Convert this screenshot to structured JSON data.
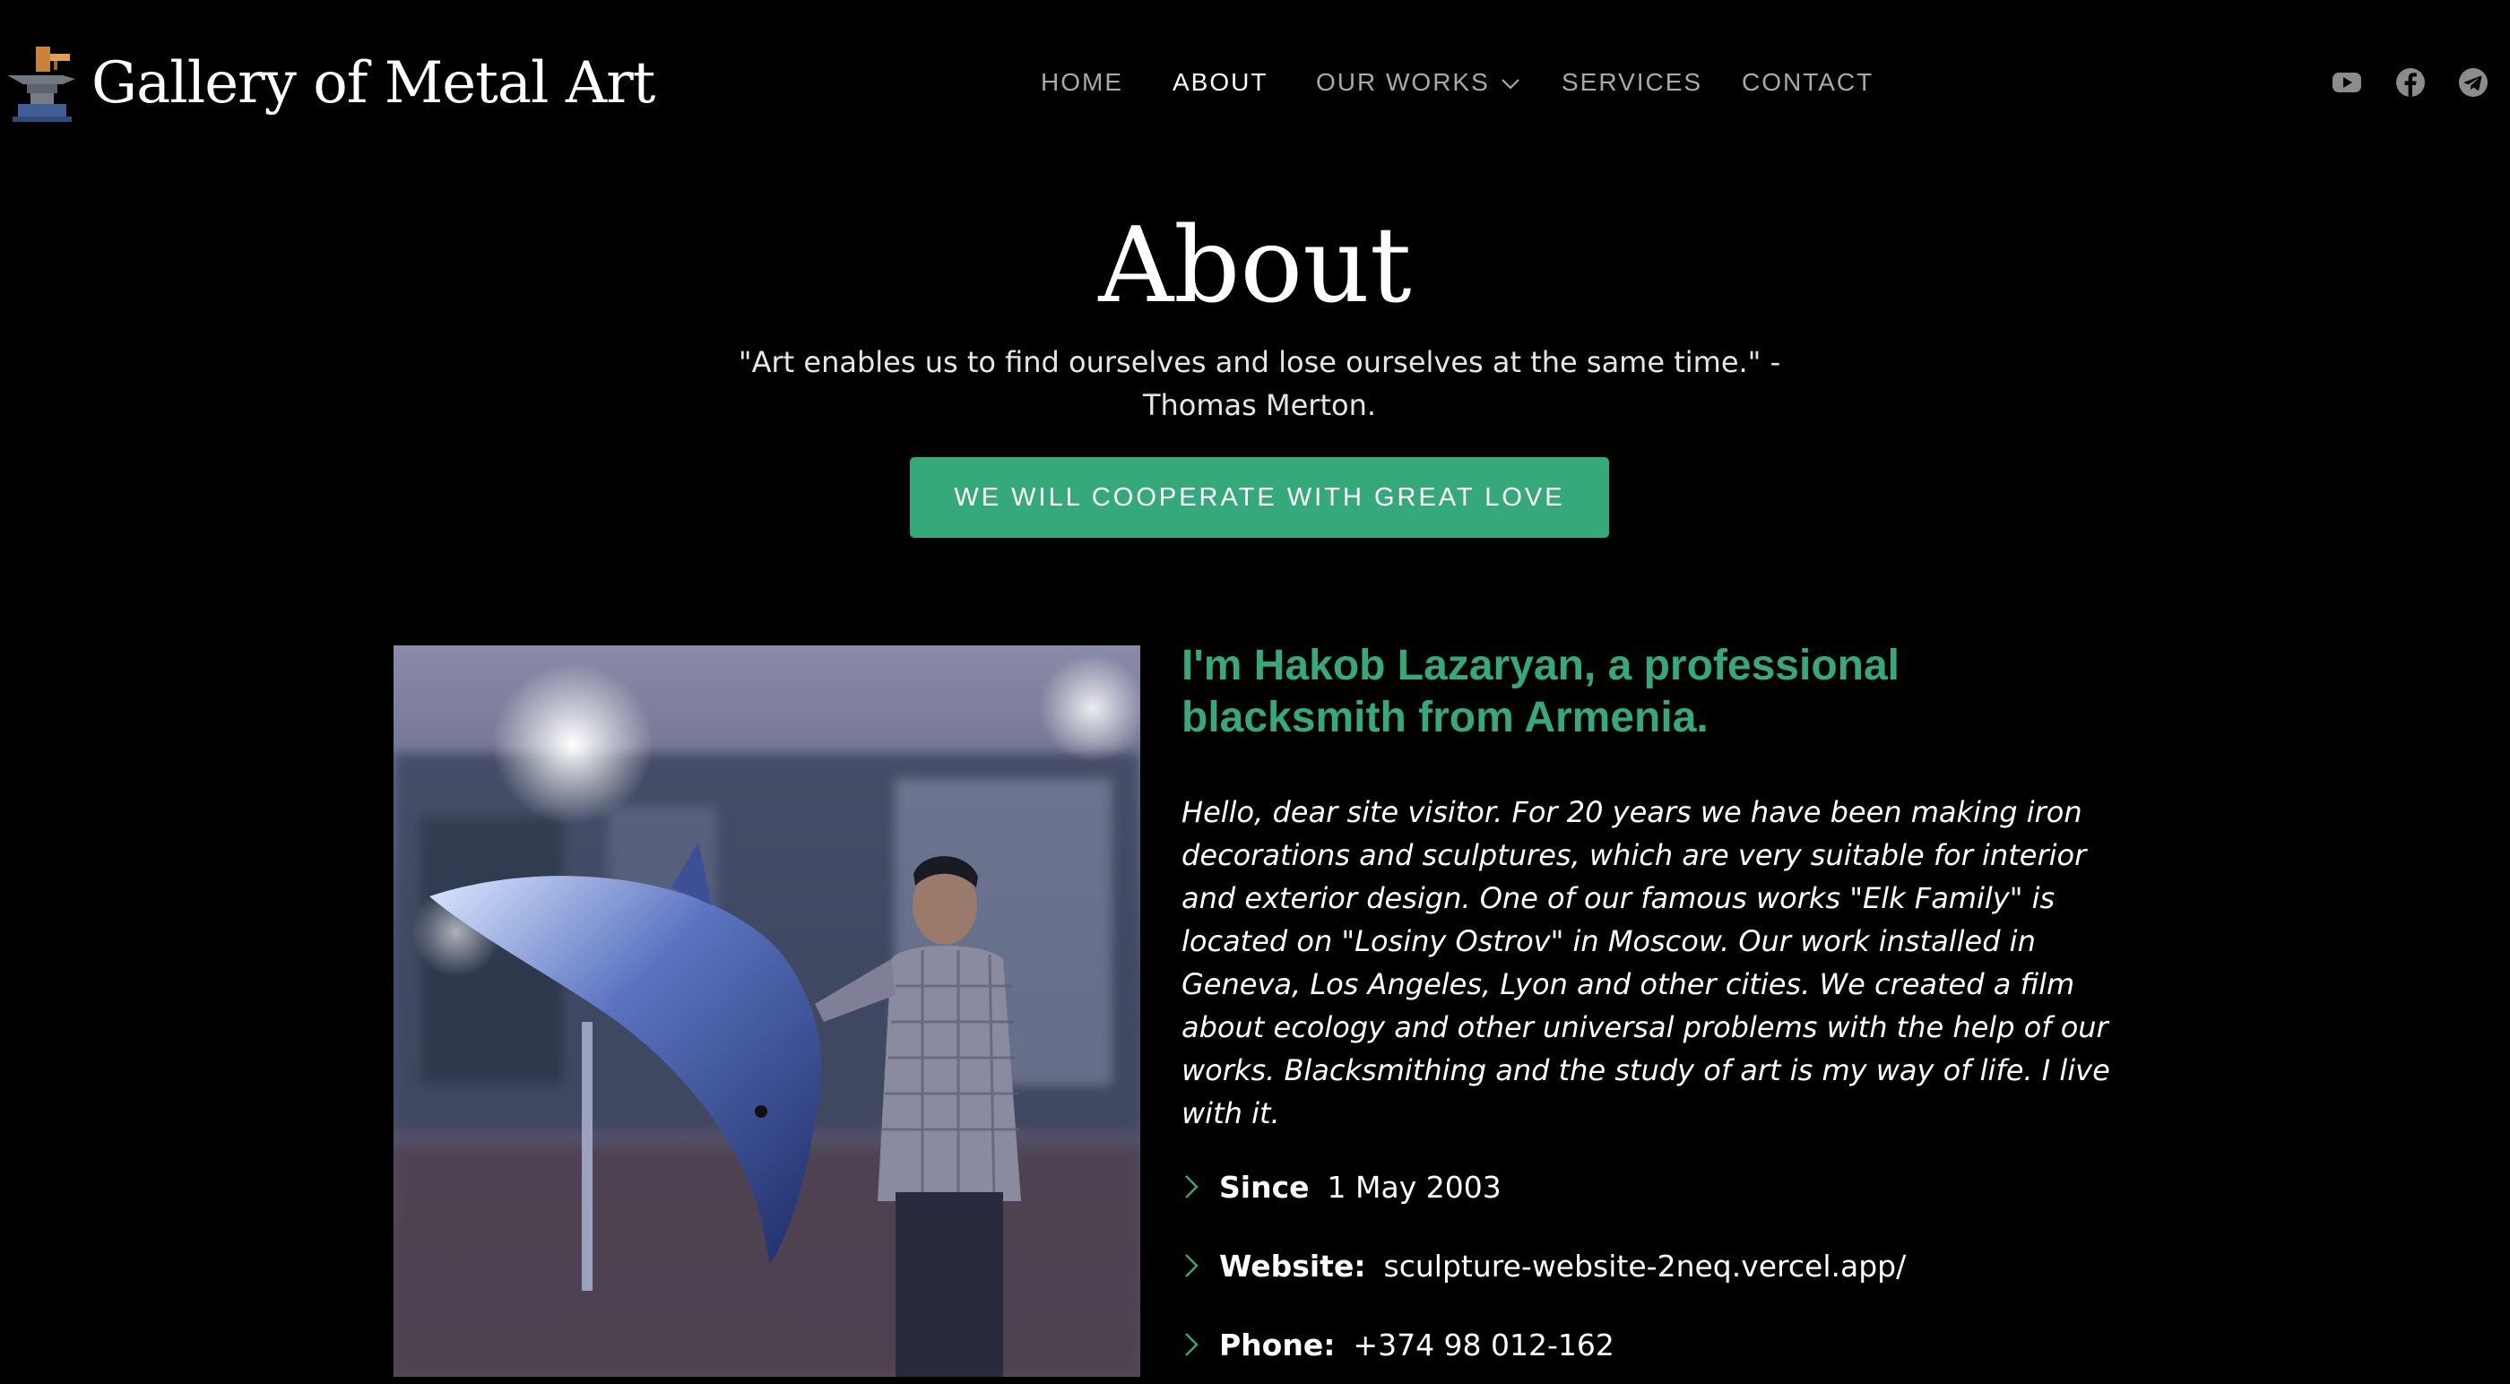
{
  "brand": {
    "name": "Gallery of Metal Art",
    "logo_icon": "anvil-logo-icon"
  },
  "nav": {
    "items": [
      {
        "label": "HOME"
      },
      {
        "label": "ABOUT",
        "active": true
      },
      {
        "label": "OUR WORKS",
        "has_dropdown": true
      },
      {
        "label": "SERVICES"
      },
      {
        "label": "CONTACT"
      }
    ],
    "dropdown_icon": "chevron-down-icon"
  },
  "social": [
    {
      "name": "youtube-icon"
    },
    {
      "name": "facebook-icon"
    },
    {
      "name": "telegram-icon"
    }
  ],
  "hero": {
    "title": "About",
    "quote": "\"Art enables us to find ourselves and lose ourselves at the same time.\" - Thomas Merton.",
    "cta_label": "WE WILL COOPERATE WITH GREAT LOVE"
  },
  "about": {
    "heading": "I'm Hakob Lazaryan, a professional blacksmith from Armenia.",
    "body": "Hello, dear site visitor. For 20 years we have been making iron decorations and sculptures, which are very suitable for interior and exterior design. One of our famous works \"Elk Family\" is located on \"Losiny Ostrov\" in Moscow. Our work installed in Geneva, Los Angeles, Lyon and other cities. We created a film about ecology and other universal problems with the help of our works. Blacksmithing and the study of art is my way of life. I live with it.",
    "facts": [
      {
        "label": "Since",
        "value": "1 May 2003"
      },
      {
        "label": "Website:",
        "value": "sculpture-website-2neq.vercel.app/"
      },
      {
        "label": "Phone:",
        "value": "+374 98 012-162"
      }
    ],
    "fact_icon": "chevron-right-icon"
  },
  "colors": {
    "accent": "#35a97a",
    "background": "#000000",
    "nav_inactive": "#a9a9a9",
    "text": "#ffffff"
  }
}
